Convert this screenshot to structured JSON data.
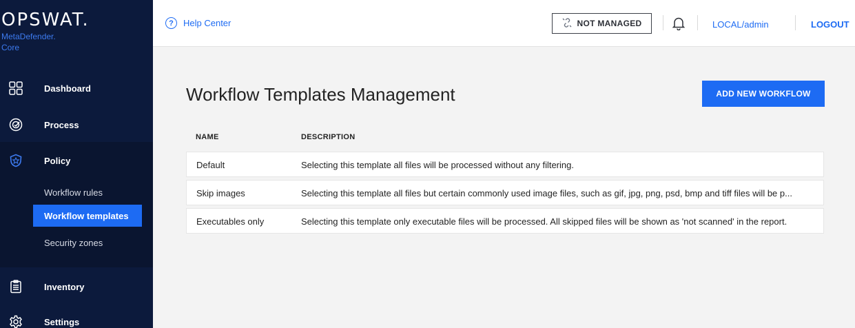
{
  "sidebar": {
    "brand": {
      "name": "OPSWAT.",
      "product": "MetaDefender.",
      "edition": "Core"
    },
    "nav": [
      {
        "label": "Dashboard",
        "icon": "dashboard-grid-icon"
      },
      {
        "label": "Process",
        "icon": "process-check-icon"
      },
      {
        "label": "Policy",
        "icon": "shield-icon"
      },
      {
        "label": "Inventory",
        "icon": "clipboard-icon"
      },
      {
        "label": "Settings",
        "icon": "gear-icon"
      }
    ],
    "policy_sub": [
      {
        "label": "Workflow rules",
        "active": false
      },
      {
        "label": "Workflow templates",
        "active": true
      },
      {
        "label": "Security zones",
        "active": false
      }
    ]
  },
  "header": {
    "help_label": "Help Center",
    "not_managed_label": "NOT MANAGED",
    "user_label": "LOCAL/admin",
    "logout_label": "LOGOUT"
  },
  "main": {
    "title": "Workflow Templates Management",
    "add_button_label": "ADD NEW WORKFLOW",
    "columns": [
      "NAME",
      "DESCRIPTION"
    ],
    "rows": [
      {
        "name": "Default",
        "description": "Selecting this template all files will be processed without any filtering."
      },
      {
        "name": "Skip images",
        "description": "Selecting this template all files but certain commonly used image files, such as gif, jpg, png, psd, bmp and tiff files will be p..."
      },
      {
        "name": "Executables only",
        "description": "Selecting this template only executable files will be processed. All skipped files will be shown as 'not scanned' in the report."
      }
    ]
  },
  "colors": {
    "sidebar": "#0c1a3c",
    "accent": "#1d6bf3",
    "background": "#f3f3f3"
  }
}
